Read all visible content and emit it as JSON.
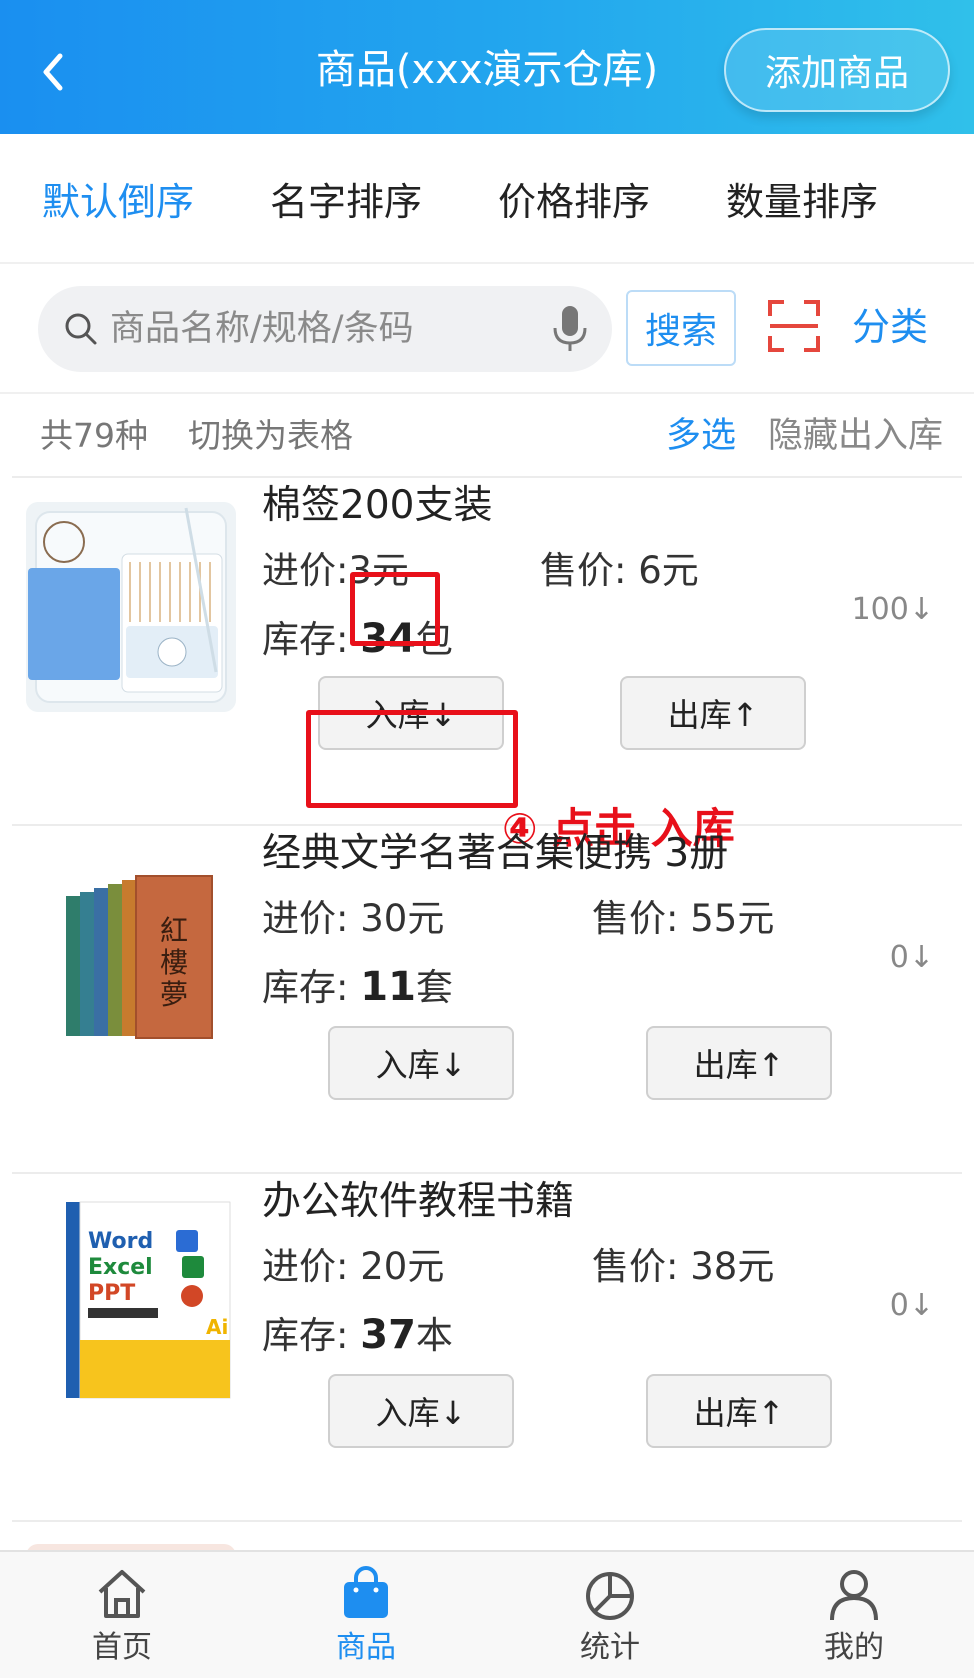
{
  "header": {
    "title": "商品(xxx演示仓库)",
    "add_button": "添加商品"
  },
  "sort_tabs": [
    {
      "label": "默认倒序",
      "active": true
    },
    {
      "label": "名字排序",
      "active": false
    },
    {
      "label": "价格排序",
      "active": false
    },
    {
      "label": "数量排序",
      "active": false
    }
  ],
  "search": {
    "placeholder": "商品名称/规格/条码",
    "button": "搜索",
    "category": "分类"
  },
  "info": {
    "count": "共79种",
    "toggle_table": "切换为表格",
    "multi_select": "多选",
    "hide_io": "隐藏出入库"
  },
  "products": [
    {
      "name": "棉签200支装",
      "purchase_label": "进价:",
      "purchase_price": "3元",
      "sale_label": "售价:",
      "sale_price": "6元",
      "stock_label": "库存:",
      "stock_qty": "34",
      "stock_unit": "包",
      "side_value": "100↓",
      "in_button": "入库↓",
      "out_button": "出库↑"
    },
    {
      "name": "经典文学名著合集便携  3册",
      "purchase_label": "进价:",
      "purchase_price": "30元",
      "sale_label": "售价:",
      "sale_price": "55元",
      "stock_label": "库存:",
      "stock_qty": "11",
      "stock_unit": "套",
      "side_value": "0↓",
      "in_button": "入库↓",
      "out_button": "出库↑"
    },
    {
      "name": "办公软件教程书籍",
      "purchase_label": "进价:",
      "purchase_price": "20元",
      "sale_label": "售价:",
      "sale_price": "38元",
      "stock_label": "库存:",
      "stock_qty": "37",
      "stock_unit": "本",
      "side_value": "0↓",
      "in_button": "入库↓",
      "out_button": "出库↑"
    }
  ],
  "annotation": "④ 点击 入库",
  "tab_bar": [
    {
      "label": "首页",
      "icon": "home-icon"
    },
    {
      "label": "商品",
      "icon": "bag-icon",
      "active": true
    },
    {
      "label": "统计",
      "icon": "pie-chart-icon"
    },
    {
      "label": "我的",
      "icon": "user-icon"
    }
  ],
  "colors": {
    "accent": "#1e8ef0",
    "annotation_red": "#e8101a",
    "header_start": "#1a8ff0",
    "header_end": "#30c0ea"
  }
}
